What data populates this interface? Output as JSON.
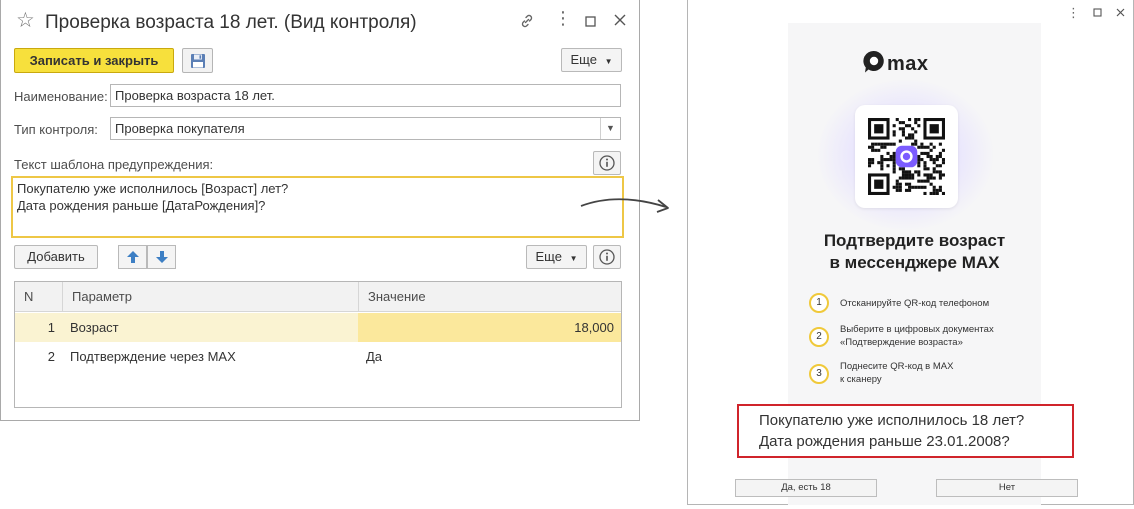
{
  "form": {
    "title": "Проверка возраста 18 лет. (Вид контроля)",
    "title_icons": [
      "star-icon",
      "link-icon",
      "more-icon",
      "maximize-icon",
      "close-icon"
    ],
    "toolbar": {
      "write_close_label": "Записать и закрыть",
      "save_icon": "floppy-disk-icon",
      "more_label": "Еще"
    },
    "name_label": "Наименование:",
    "name_value": "Проверка возраста 18 лет.",
    "control_type_label": "Тип контроля:",
    "control_type_value": "Проверка покупателя",
    "template_label": "Текст шаблона предупреждения:",
    "template_lines": [
      "Покупателю уже исполнилось [Возраст] лет?",
      "Дата рождения раньше [ДатаРождения]?"
    ],
    "params_toolbar": {
      "add_label": "Добавить",
      "more_label": "Еще"
    },
    "table": {
      "columns": [
        "N",
        "Параметр",
        "Значение"
      ],
      "rows": [
        {
          "n": "1",
          "param": "Возраст",
          "value": "18,000",
          "selected": true
        },
        {
          "n": "2",
          "param": "Подтверждение через MAX",
          "value": "Да",
          "selected": false
        }
      ]
    }
  },
  "dialog": {
    "title_icons": [
      "more-icon",
      "maximize-icon",
      "close-icon"
    ],
    "brand": "max",
    "heading_lines": [
      "Подтвердите возраст",
      "в мессенджере MAX"
    ],
    "steps": [
      {
        "num": "1",
        "lines": [
          "Отсканируйте QR-код телефоном"
        ]
      },
      {
        "num": "2",
        "lines": [
          "Выберите в цифровых документах",
          "«Подтверждение возраста»"
        ]
      },
      {
        "num": "3",
        "lines": [
          "Поднесите QR-код в MAX",
          "к сканеру"
        ]
      }
    ],
    "message_lines": [
      "Покупателю уже исполнилось 18 лет?",
      "Дата рождения раньше 23.01.2008?"
    ],
    "yes_label": "Да, есть 18",
    "no_label": "Нет"
  },
  "colors": {
    "accent_yellow": "#f7e03c",
    "template_border": "#eec746",
    "selected_row": "#faf3d2",
    "message_border": "#d0242b",
    "brand_dark": "#222222",
    "qr_glow": "#dcd6ff"
  }
}
